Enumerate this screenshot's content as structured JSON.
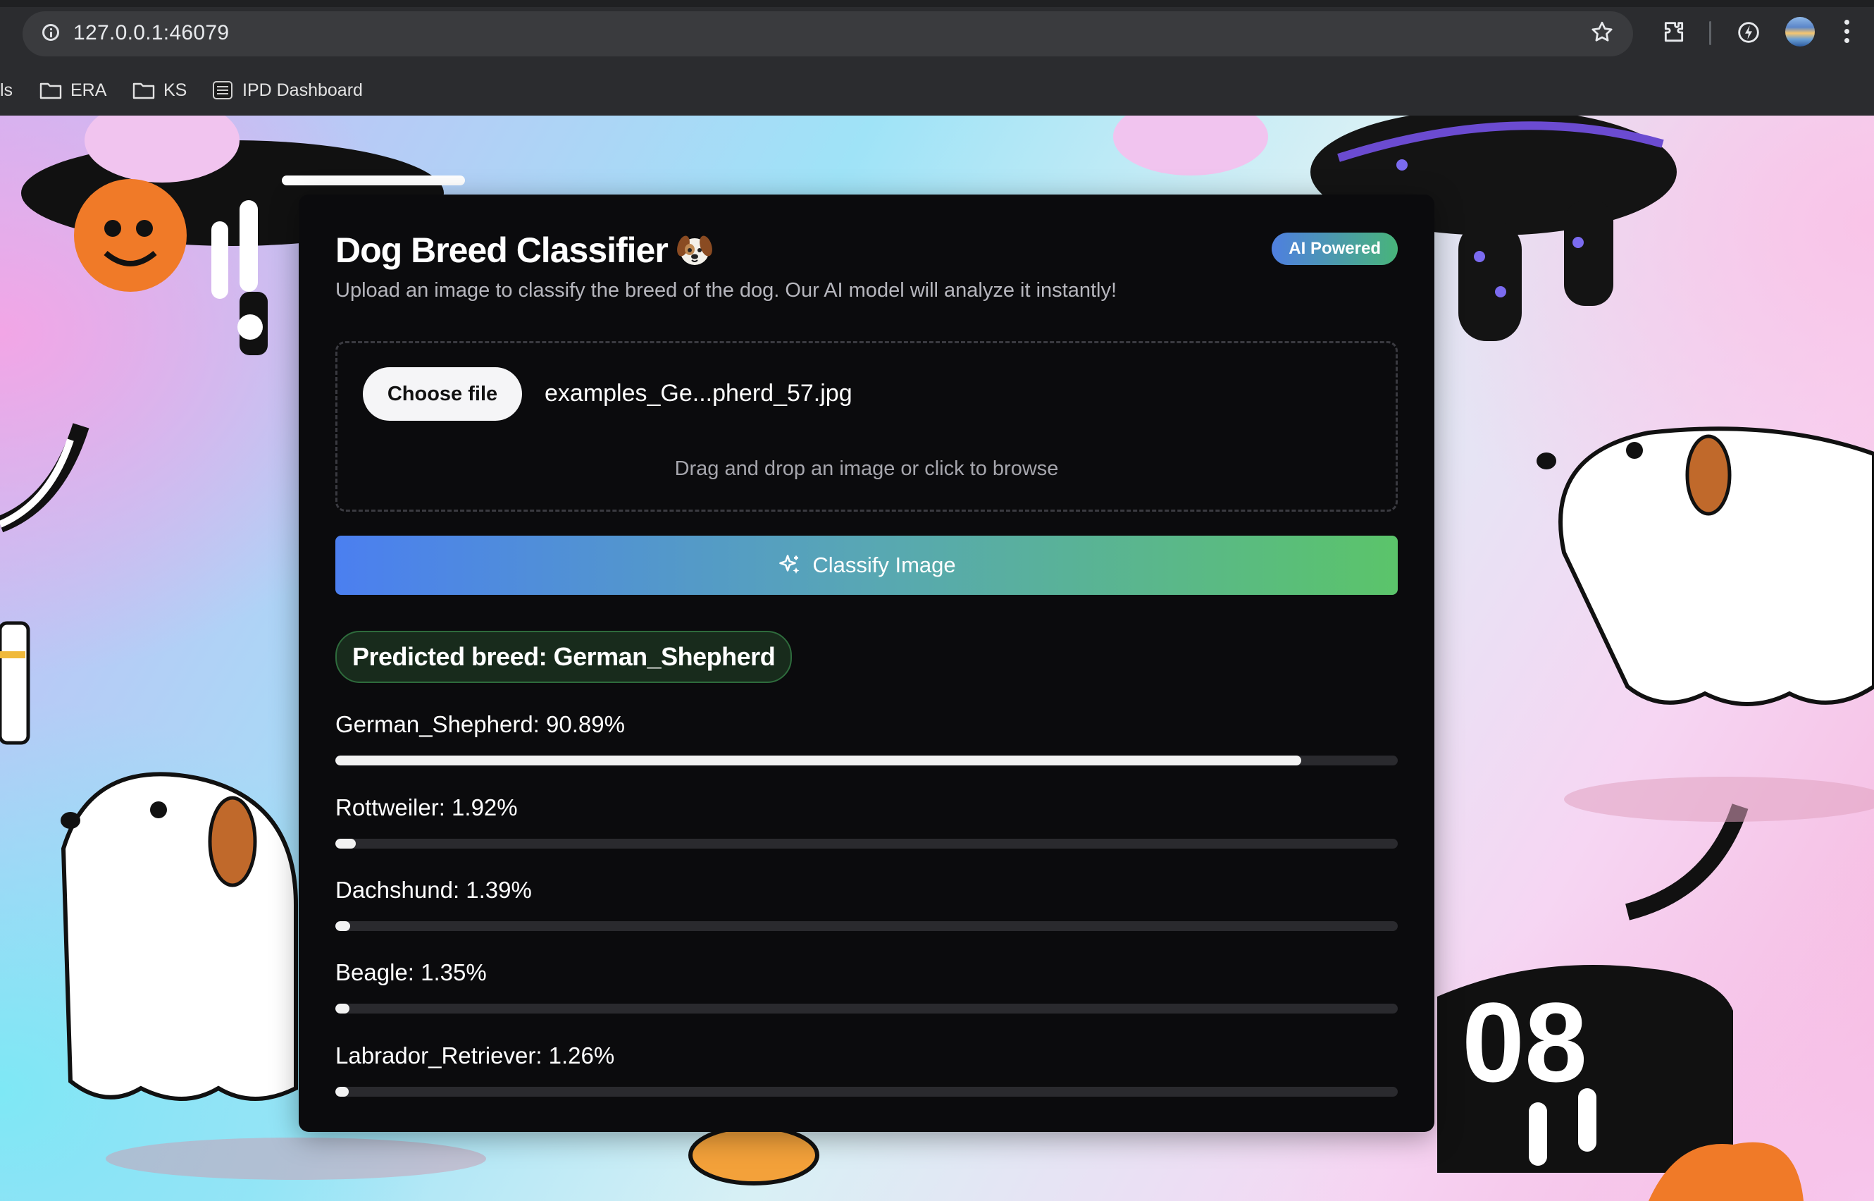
{
  "browser": {
    "url": "127.0.0.1:46079",
    "bookmarks": [
      {
        "label": "ls",
        "icon": "none"
      },
      {
        "label": "ERA",
        "icon": "folder-icon"
      },
      {
        "label": "KS",
        "icon": "folder-icon"
      },
      {
        "label": "IPD Dashboard",
        "icon": "favicon"
      }
    ]
  },
  "app": {
    "title": "Dog Breed Classifier",
    "title_emoji": "dog-face-icon",
    "badge": "AI Powered",
    "subtitle": "Upload an image to classify the breed of the dog. Our AI model will analyze it instantly!",
    "upload": {
      "button_label": "Choose file",
      "file_name": "examples_Ge...pherd_57.jpg",
      "hint": "Drag and drop an image or click to browse"
    },
    "classify_button": "Classify Image",
    "prediction": "Predicted breed: German_Shepherd",
    "results": [
      {
        "label": "German_Shepherd: 90.89%",
        "value": 0.9089
      },
      {
        "label": "Rottweiler: 1.92%",
        "value": 0.0192
      },
      {
        "label": "Dachshund: 1.39%",
        "value": 0.0139
      },
      {
        "label": "Beagle: 1.35%",
        "value": 0.0135
      },
      {
        "label": "Labrador_Retriever: 1.26%",
        "value": 0.0126
      }
    ]
  },
  "colors": {
    "card_bg": "#0b0b0d",
    "badge_gradient": [
      "#4f7fe0",
      "#48b47a"
    ],
    "button_gradient": [
      "#4b7ff0",
      "#5bc46a"
    ],
    "prediction_bg": "#182b1c"
  }
}
